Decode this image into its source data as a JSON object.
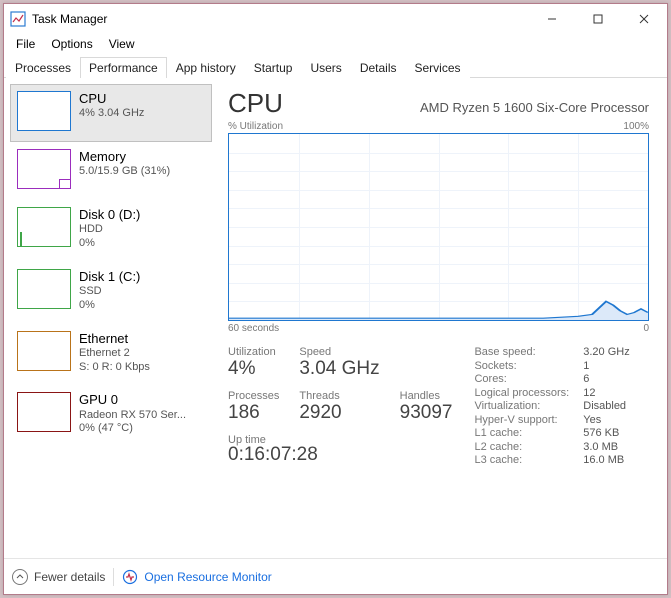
{
  "window": {
    "title": "Task Manager"
  },
  "menu": {
    "file": "File",
    "options": "Options",
    "view": "View"
  },
  "tabs": {
    "processes": "Processes",
    "performance": "Performance",
    "apphistory": "App history",
    "startup": "Startup",
    "users": "Users",
    "details": "Details",
    "services": "Services"
  },
  "sidebar": {
    "cpu": {
      "title": "CPU",
      "sub1": "4% 3.04 GHz"
    },
    "mem": {
      "title": "Memory",
      "sub1": "5.0/15.9 GB (31%)"
    },
    "disk0": {
      "title": "Disk 0 (D:)",
      "sub1": "HDD",
      "sub2": "0%"
    },
    "disk1": {
      "title": "Disk 1 (C:)",
      "sub1": "SSD",
      "sub2": "0%"
    },
    "eth": {
      "title": "Ethernet",
      "sub1": "Ethernet 2",
      "sub2": "S: 0 R: 0 Kbps"
    },
    "gpu": {
      "title": "GPU 0",
      "sub1": "Radeon RX 570 Ser...",
      "sub2": "0%  (47 °C)"
    }
  },
  "detail": {
    "heading": "CPU",
    "model": "AMD Ryzen 5 1600 Six-Core Processor",
    "graph_top_left": "% Utilization",
    "graph_top_right": "100%",
    "graph_bot_left": "60 seconds",
    "graph_bot_right": "0",
    "left": {
      "util_lbl": "Utilization",
      "util_val": "4%",
      "speed_lbl": "Speed",
      "speed_val": "3.04 GHz",
      "proc_lbl": "Processes",
      "proc_val": "186",
      "thr_lbl": "Threads",
      "thr_val": "2920",
      "hnd_lbl": "Handles",
      "hnd_val": "93097",
      "uptime_lbl": "Up time",
      "uptime_val": "0:16:07:28"
    },
    "right": {
      "base_k": "Base speed:",
      "base_v": "3.20 GHz",
      "sock_k": "Sockets:",
      "sock_v": "1",
      "core_k": "Cores:",
      "core_v": "6",
      "lp_k": "Logical processors:",
      "lp_v": "12",
      "virt_k": "Virtualization:",
      "virt_v": "Disabled",
      "hv_k": "Hyper-V support:",
      "hv_v": "Yes",
      "l1_k": "L1 cache:",
      "l1_v": "576 KB",
      "l2_k": "L2 cache:",
      "l2_v": "3.0 MB",
      "l3_k": "L3 cache:",
      "l3_v": "16.0 MB"
    }
  },
  "footer": {
    "fewer": "Fewer details",
    "orm": "Open Resource Monitor"
  },
  "chart_data": {
    "type": "line",
    "title": "% Utilization",
    "xlabel": "seconds ago",
    "ylabel": "% Utilization",
    "xlim": [
      60,
      0
    ],
    "ylim": [
      0,
      100
    ],
    "x": [
      60,
      55,
      50,
      45,
      40,
      35,
      30,
      25,
      20,
      15,
      10,
      8,
      6,
      5,
      4,
      3,
      2,
      1,
      0
    ],
    "values": [
      1,
      1,
      1,
      1,
      1,
      1,
      1,
      1,
      1,
      1,
      2,
      3,
      10,
      8,
      5,
      3,
      4,
      6,
      4
    ]
  }
}
